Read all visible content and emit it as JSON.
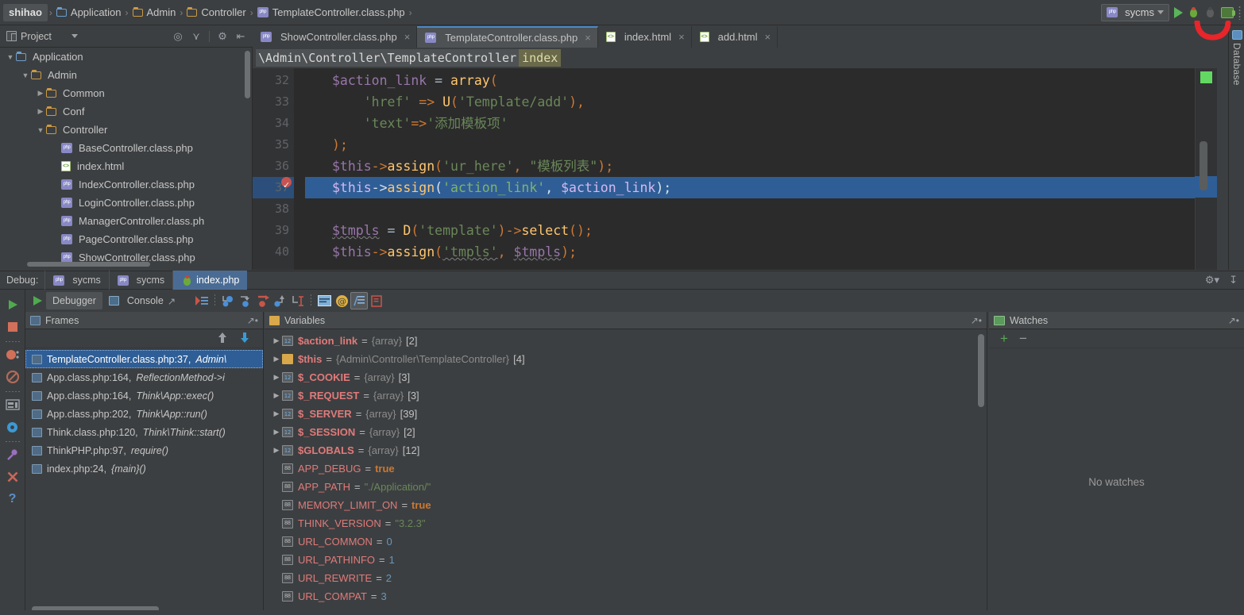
{
  "breadcrumb": {
    "items": [
      {
        "label": "shihao",
        "icon": "none"
      },
      {
        "label": "Application",
        "icon": "folder-blue"
      },
      {
        "label": "Admin",
        "icon": "folder"
      },
      {
        "label": "Controller",
        "icon": "folder"
      },
      {
        "label": "TemplateController.class.php",
        "icon": "php-file"
      }
    ],
    "separator": "›"
  },
  "toolbar_right": {
    "run_config": "sycms",
    "run_icon": "run-triangle-icon",
    "debug_icon": "debug-bug-icon",
    "rerun_icon": "rerun-bug-icon",
    "coverage_icon": "coverage-icon"
  },
  "project_panel": {
    "title": "Project",
    "icons": [
      "project-icon",
      "chevron-down-icon",
      "locate-icon",
      "collapse-icon",
      "gear-icon",
      "hide-icon"
    ]
  },
  "editor_tabs": [
    {
      "label": "ShowController.class.php",
      "icon": "php-file",
      "active": false,
      "close": "×"
    },
    {
      "label": "TemplateController.class.php",
      "icon": "php-file",
      "active": true,
      "close": "×"
    },
    {
      "label": "index.html",
      "icon": "html-file",
      "active": false,
      "close": "×"
    },
    {
      "label": "add.html",
      "icon": "html-file",
      "active": false,
      "close": "×"
    }
  ],
  "tree": {
    "nodes": [
      {
        "label": "Application",
        "indent": 1,
        "arrow": "▼",
        "icon": "folder-blue"
      },
      {
        "label": "Admin",
        "indent": 2,
        "arrow": "▼",
        "icon": "folder"
      },
      {
        "label": "Common",
        "indent": 3,
        "arrow": "▶",
        "icon": "folder"
      },
      {
        "label": "Conf",
        "indent": 3,
        "arrow": "▶",
        "icon": "folder"
      },
      {
        "label": "Controller",
        "indent": 3,
        "arrow": "▼",
        "icon": "folder"
      },
      {
        "label": "BaseController.class.php",
        "indent": 4,
        "arrow": "",
        "icon": "php-file"
      },
      {
        "label": "index.html",
        "indent": 4,
        "arrow": "",
        "icon": "html-file"
      },
      {
        "label": "IndexController.class.php",
        "indent": 4,
        "arrow": "",
        "icon": "php-file"
      },
      {
        "label": "LoginController.class.php",
        "indent": 4,
        "arrow": "",
        "icon": "php-file"
      },
      {
        "label": "ManagerController.class.ph",
        "indent": 4,
        "arrow": "",
        "icon": "php-file"
      },
      {
        "label": "PageController.class.php",
        "indent": 4,
        "arrow": "",
        "icon": "php-file"
      },
      {
        "label": "ShowController.class.php",
        "indent": 4,
        "arrow": "",
        "icon": "php-file"
      }
    ]
  },
  "editor": {
    "breadcrumb_path": "\\Admin\\Controller\\TemplateController",
    "breadcrumb_method": "index",
    "line_numbers": [
      "32",
      "33",
      "34",
      "35",
      "36",
      "37",
      "38",
      "39",
      "40"
    ],
    "highlighted_line": "37",
    "breakpoint_line": "37",
    "code": [
      {
        "n": "32",
        "tokens": [
          {
            "t": "$action_link",
            "c": "k-var"
          },
          {
            "t": " = ",
            "c": "k-plain"
          },
          {
            "t": "array",
            "c": "k-fn"
          },
          {
            "t": "(",
            "c": "k-punc"
          }
        ]
      },
      {
        "n": "33",
        "tokens": [
          {
            "t": "    ",
            "c": "k-plain"
          },
          {
            "t": "'href'",
            "c": "k-str"
          },
          {
            "t": " => ",
            "c": "k-punc"
          },
          {
            "t": "U",
            "c": "k-fn"
          },
          {
            "t": "(",
            "c": "k-punc"
          },
          {
            "t": "'Template/add'",
            "c": "k-str"
          },
          {
            "t": ")",
            "c": "k-punc"
          },
          {
            "t": ",",
            "c": "k-punc"
          }
        ]
      },
      {
        "n": "34",
        "tokens": [
          {
            "t": "    ",
            "c": "k-plain"
          },
          {
            "t": "'text'",
            "c": "k-str"
          },
          {
            "t": "=>",
            "c": "k-punc"
          },
          {
            "t": "'添加模板项'",
            "c": "k-str"
          }
        ]
      },
      {
        "n": "35",
        "tokens": [
          {
            "t": ")",
            "c": "k-punc"
          },
          {
            "t": ";",
            "c": "k-punc"
          }
        ]
      },
      {
        "n": "36",
        "tokens": [
          {
            "t": "$this",
            "c": "k-var"
          },
          {
            "t": "->",
            "c": "k-punc"
          },
          {
            "t": "assign",
            "c": "k-fn"
          },
          {
            "t": "(",
            "c": "k-punc"
          },
          {
            "t": "'ur_here'",
            "c": "k-str"
          },
          {
            "t": ", ",
            "c": "k-punc"
          },
          {
            "t": "\"模板列表\"",
            "c": "k-str"
          },
          {
            "t": ")",
            "c": "k-punc"
          },
          {
            "t": ";",
            "c": "k-punc"
          }
        ]
      },
      {
        "n": "37",
        "tokens": [
          {
            "t": "$this",
            "c": "k-sel-var"
          },
          {
            "t": "->",
            "c": "k-sel-plain"
          },
          {
            "t": "assign",
            "c": "k-sel-fn"
          },
          {
            "t": "(",
            "c": "k-sel-plain"
          },
          {
            "t": "'action_link'",
            "c": "k-sel-str"
          },
          {
            "t": ", ",
            "c": "k-sel-plain"
          },
          {
            "t": "$action_link",
            "c": "k-sel-var"
          },
          {
            "t": ")",
            "c": "k-sel-plain"
          },
          {
            "t": ";",
            "c": "k-sel-plain"
          }
        ]
      },
      {
        "n": "38",
        "tokens": []
      },
      {
        "n": "39",
        "tokens": [
          {
            "t": "$tmpls",
            "c": "k-var underwave"
          },
          {
            "t": " = ",
            "c": "k-plain"
          },
          {
            "t": "D",
            "c": "k-fn"
          },
          {
            "t": "(",
            "c": "k-punc"
          },
          {
            "t": "'template'",
            "c": "k-str"
          },
          {
            "t": ")",
            "c": "k-punc"
          },
          {
            "t": "->",
            "c": "k-punc"
          },
          {
            "t": "select",
            "c": "k-fn"
          },
          {
            "t": "()",
            "c": "k-punc"
          },
          {
            "t": ";",
            "c": "k-punc"
          }
        ]
      },
      {
        "n": "40",
        "tokens": [
          {
            "t": "$this",
            "c": "k-var"
          },
          {
            "t": "->",
            "c": "k-punc"
          },
          {
            "t": "assign",
            "c": "k-fn"
          },
          {
            "t": "(",
            "c": "k-punc"
          },
          {
            "t": "'tmpls'",
            "c": "k-str underwave"
          },
          {
            "t": ", ",
            "c": "k-punc"
          },
          {
            "t": "$tmpls",
            "c": "k-var underwave"
          },
          {
            "t": ")",
            "c": "k-punc"
          },
          {
            "t": ";",
            "c": "k-punc"
          }
        ]
      }
    ]
  },
  "right_strip": {
    "label": "Database",
    "icon": "database-icon"
  },
  "debug_window": {
    "label": "Debug:",
    "tabs": [
      {
        "label": "sycms",
        "icon": "php-file",
        "active": false
      },
      {
        "label": "sycms",
        "icon": "php-file",
        "active": false
      },
      {
        "label": "index.php",
        "icon": "bug-icon",
        "active": true
      }
    ],
    "header_icons": [
      "gear-icon",
      "hide-icon"
    ],
    "toolbar": {
      "resume_icon": "resume-program-icon",
      "buttons": [
        {
          "label": "Debugger",
          "icon": "debugger-icon",
          "selected": true
        },
        {
          "label": "Console",
          "icon": "console-icon",
          "selected": false
        }
      ],
      "step_icons": [
        "show-execution-point-icon",
        "step-over-icon",
        "step-into-icon",
        "force-step-into-icon",
        "step-out-icon",
        "run-to-cursor-icon",
        "evaluate-expression-icon",
        "at-icon",
        "settings-icon",
        "layout-icon"
      ]
    },
    "left_rail_icons": [
      "resume-icon",
      "stop-icon",
      "view-breakpoints-icon",
      "mute-breakpoints-icon",
      "restore-layout-icon",
      "settings-gear-icon",
      "pin-icon",
      "close-icon",
      "help-icon"
    ]
  },
  "frames": {
    "title": "Frames",
    "hide_icon": "hide-icon",
    "nav_icons": [
      "up-arrow-icon",
      "down-arrow-icon"
    ],
    "rows": [
      {
        "file": "TemplateController.class.php:37,",
        "detail": "Admin\\",
        "selected": true
      },
      {
        "file": "App.class.php:164,",
        "detail": "ReflectionMethod->i",
        "selected": false
      },
      {
        "file": "App.class.php:164,",
        "detail": "Think\\App::exec()",
        "selected": false
      },
      {
        "file": "App.class.php:202,",
        "detail": "Think\\App::run()",
        "selected": false
      },
      {
        "file": "Think.class.php:120,",
        "detail": "Think\\Think::start()",
        "selected": false
      },
      {
        "file": "ThinkPHP.php:97,",
        "detail": "require()",
        "selected": false
      },
      {
        "file": "index.php:24,",
        "detail": "{main}()",
        "selected": false
      }
    ]
  },
  "variables": {
    "title": "Variables",
    "hide_icon": "hide-icon",
    "rows": [
      {
        "arrow": "▶",
        "kind": "array",
        "name": "$action_link",
        "eq": "=",
        "type": "{array}",
        "count": "[2]"
      },
      {
        "arrow": "▶",
        "kind": "object",
        "name": "$this",
        "eq": "=",
        "type": "{Admin\\Controller\\TemplateController}",
        "count": "[4]"
      },
      {
        "arrow": "▶",
        "kind": "array",
        "name": "$_COOKIE",
        "eq": "=",
        "type": "{array}",
        "count": "[3]"
      },
      {
        "arrow": "▶",
        "kind": "array",
        "name": "$_REQUEST",
        "eq": "=",
        "type": "{array}",
        "count": "[3]"
      },
      {
        "arrow": "▶",
        "kind": "array",
        "name": "$_SERVER",
        "eq": "=",
        "type": "{array}",
        "count": "[39]"
      },
      {
        "arrow": "▶",
        "kind": "array",
        "name": "$_SESSION",
        "eq": "=",
        "type": "{array}",
        "count": "[2]"
      },
      {
        "arrow": "▶",
        "kind": "array",
        "name": "$GLOBALS",
        "eq": "=",
        "type": "{array}",
        "count": "[12]"
      },
      {
        "arrow": "",
        "kind": "const",
        "name": "APP_DEBUG",
        "eq": "=",
        "value": "true",
        "vclass": "v-true"
      },
      {
        "arrow": "",
        "kind": "const",
        "name": "APP_PATH",
        "eq": "=",
        "value": "\"./Application/\"",
        "vclass": "v-str"
      },
      {
        "arrow": "",
        "kind": "const",
        "name": "MEMORY_LIMIT_ON",
        "eq": "=",
        "value": "true",
        "vclass": "v-true"
      },
      {
        "arrow": "",
        "kind": "const",
        "name": "THINK_VERSION",
        "eq": "=",
        "value": "\"3.2.3\"",
        "vclass": "v-str"
      },
      {
        "arrow": "",
        "kind": "const",
        "name": "URL_COMMON",
        "eq": "=",
        "value": "0",
        "vclass": "v-num"
      },
      {
        "arrow": "",
        "kind": "const",
        "name": "URL_PATHINFO",
        "eq": "=",
        "value": "1",
        "vclass": "v-num"
      },
      {
        "arrow": "",
        "kind": "const",
        "name": "URL_REWRITE",
        "eq": "=",
        "value": "2",
        "vclass": "v-num"
      },
      {
        "arrow": "",
        "kind": "const",
        "name": "URL_COMPAT",
        "eq": "=",
        "value": "3",
        "vclass": "v-num"
      }
    ]
  },
  "watches": {
    "title": "Watches",
    "hide_icon": "hide-icon",
    "add_label": "+",
    "remove_label": "−",
    "empty_text": "No watches"
  },
  "colors": {
    "accent_blue": "#2f5e96",
    "panel_bg": "#3c3f41",
    "editor_bg": "#2b2b2b",
    "string_green": "#6a8759",
    "keyword_orange": "#cc7832",
    "function_yellow": "#ffc66d",
    "variable_purple": "#9876aa",
    "error_red": "#c75450",
    "annotation_red": "#e8252a"
  }
}
